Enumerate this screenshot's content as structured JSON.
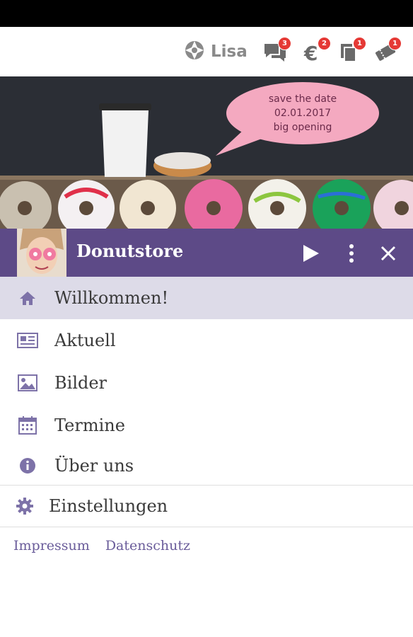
{
  "toolbar": {
    "user_name": "Lisa",
    "badges": {
      "messages": "3",
      "payments": "2",
      "documents": "1",
      "tickets": "1"
    }
  },
  "banner": {
    "bubble_lines": [
      "save the date",
      "02.01.2017",
      "big opening"
    ]
  },
  "appbar": {
    "title": "Donutstore"
  },
  "menu": {
    "items": [
      {
        "label": "Willkommen!",
        "icon": "home-icon"
      },
      {
        "label": "Aktuell",
        "icon": "newspaper-icon"
      },
      {
        "label": "Bilder",
        "icon": "image-icon"
      },
      {
        "label": "Termine",
        "icon": "calendar-icon"
      },
      {
        "label": "Über uns",
        "icon": "info-icon"
      }
    ],
    "settings": {
      "label": "Einstellungen",
      "icon": "gear-icon"
    }
  },
  "footer": {
    "impressum": "Impressum",
    "datenschutz": "Datenschutz"
  },
  "colors": {
    "accent": "#5d4a87",
    "active_bg": "#dddbe8",
    "badge": "#e53935",
    "link": "#6a5c9a"
  }
}
